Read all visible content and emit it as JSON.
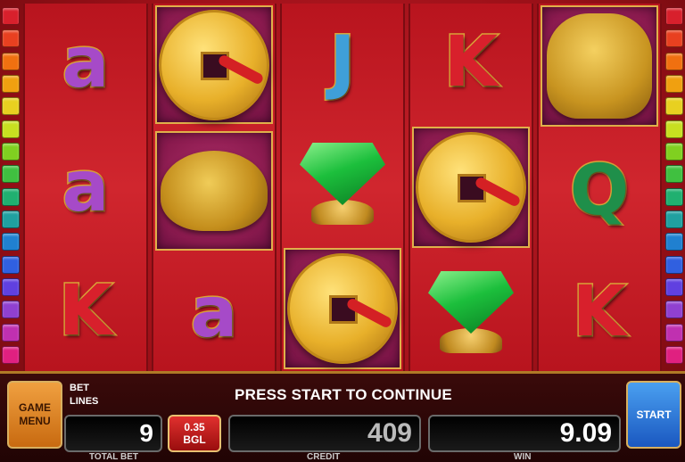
{
  "indicator_colors": [
    "#d8202c",
    "#e84020",
    "#f07010",
    "#f0a010",
    "#e8d020",
    "#c8e020",
    "#80d020",
    "#40c040",
    "#20b070",
    "#20a0a0",
    "#2080d0",
    "#3060e0",
    "#6040e0",
    "#9040d0",
    "#c030b0",
    "#e02080"
  ],
  "reels": [
    [
      {
        "type": "letter",
        "char": "a",
        "color": "purple"
      },
      {
        "type": "letter",
        "char": "a",
        "color": "purple"
      },
      {
        "type": "letter",
        "char": "K",
        "color": "red"
      }
    ],
    [
      {
        "type": "coin",
        "framed": true
      },
      {
        "type": "toad",
        "framed": true
      },
      {
        "type": "letter",
        "char": "a",
        "color": "purple"
      }
    ],
    [
      {
        "type": "letter",
        "char": "J",
        "color": "blue"
      },
      {
        "type": "gem"
      },
      {
        "type": "coin",
        "framed": true
      }
    ],
    [
      {
        "type": "letter",
        "char": "K",
        "color": "red"
      },
      {
        "type": "coin",
        "framed": true
      },
      {
        "type": "gem"
      }
    ],
    [
      {
        "type": "dog",
        "framed": true
      },
      {
        "type": "letter",
        "char": "Q",
        "color": "green"
      },
      {
        "type": "letter",
        "char": "K",
        "color": "red"
      }
    ]
  ],
  "panel": {
    "game_menu_label_1": "GAME",
    "game_menu_label_2": "MENU",
    "bet_label": "BET",
    "lines_label": "LINES",
    "message": "PRESS START TO CONTINUE",
    "total_bet_value": "9",
    "total_bet_caption": "TOTAL BET",
    "denom_value": "0.35",
    "denom_currency": "BGL",
    "credit_value": "409",
    "credit_caption": "CREDIT",
    "win_value": "9.09",
    "win_caption": "WIN",
    "start_label": "START"
  }
}
